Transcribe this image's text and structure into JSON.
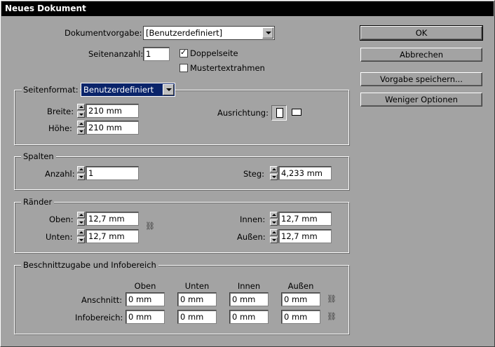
{
  "window": {
    "title": "Neues Dokument"
  },
  "top": {
    "preset_label": "Dokumentvorgabe:",
    "preset_value": "[Benutzerdefiniert]",
    "pages_label": "Seitenanzahl:",
    "pages_value": "1",
    "facing_label": "Doppelseite",
    "facing_checked": true,
    "master_label": "Mustertextrahmen",
    "master_checked": false
  },
  "page_size": {
    "label": "Seitenformat:",
    "value": "Benutzerdefiniert",
    "width_label": "Breite:",
    "width_value": "210 mm",
    "height_label": "Höhe:",
    "height_value": "210 mm",
    "orientation_label": "Ausrichtung:",
    "orientation_selected": "portrait"
  },
  "columns": {
    "title": "Spalten",
    "count_label": "Anzahl:",
    "count_value": "1",
    "gutter_label": "Steg:",
    "gutter_value": "4,233 mm"
  },
  "margins": {
    "title": "Ränder",
    "top_label": "Oben:",
    "top_value": "12,7 mm",
    "bottom_label": "Unten:",
    "bottom_value": "12,7 mm",
    "inside_label": "Innen:",
    "inside_value": "12,7 mm",
    "outside_label": "Außen:",
    "outside_value": "12,7 mm"
  },
  "bleed": {
    "title": "Beschnittzugabe und Infobereich",
    "col_headers": [
      "Oben",
      "Unten",
      "Innen",
      "Außen"
    ],
    "bleed_label": "Anschnitt:",
    "bleed_values": [
      "0 mm",
      "0 mm",
      "0 mm",
      "0 mm"
    ],
    "slug_label": "Infobereich:",
    "slug_values": [
      "0 mm",
      "0 mm",
      "0 mm",
      "0 mm"
    ]
  },
  "buttons": {
    "ok": "OK",
    "cancel": "Abbrechen",
    "save_preset": "Vorgabe speichern...",
    "fewer_options": "Weniger Optionen"
  },
  "icons": {
    "chain": "chain-link-icon",
    "portrait": "portrait-orientation-icon",
    "landscape": "landscape-orientation-icon"
  }
}
